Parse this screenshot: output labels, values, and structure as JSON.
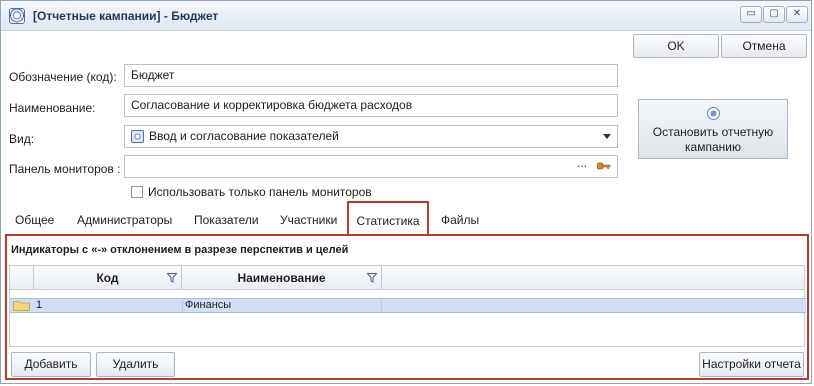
{
  "window": {
    "title": "[Отчетные кампании] - Бюджет",
    "min_glyph": "▭",
    "max_glyph": "▢",
    "close_glyph": "✕"
  },
  "dialog": {
    "ok_label": "OK",
    "cancel_label": "Отмена"
  },
  "form": {
    "code_label": "Обозначение (код):",
    "code_value": "Бюджет",
    "name_label": "Наименование:",
    "name_value": "Согласование и корректировка бюджета расходов",
    "type_label": "Вид:",
    "type_value": "Ввод и согласование показателей",
    "monitor_label": "Панель мониторов :",
    "monitor_value": "",
    "monitor_ellipsis": "...",
    "only_monitors_label": "Использовать только панель мониторов",
    "only_monitors_checked": false,
    "stop_button_label": "Остановить отчетную кампанию"
  },
  "tabs": [
    {
      "label": "Общее"
    },
    {
      "label": "Администраторы"
    },
    {
      "label": "Показатели"
    },
    {
      "label": "Участники"
    },
    {
      "label": "Статистика",
      "active": true
    },
    {
      "label": "Файлы"
    }
  ],
  "panel": {
    "title": "Индикаторы с «-» отклонением в разрезе перспектив и целей",
    "columns": [
      "Код",
      "Наименование"
    ],
    "rows": [
      {
        "code": "1",
        "name": "Финансы"
      }
    ],
    "add_label": "Добавить",
    "delete_label": "Удалить",
    "report_settings_label": "Настройки отчета"
  },
  "icons": {
    "app": "campaign-icon",
    "type": "campaign-icon",
    "key": "key-icon",
    "stop": "stop-circle-icon",
    "filter": "filter-icon",
    "folder": "folder-icon"
  },
  "colors": {
    "highlight_border": "#c0392b",
    "selected_row": "#cfe0f4"
  }
}
